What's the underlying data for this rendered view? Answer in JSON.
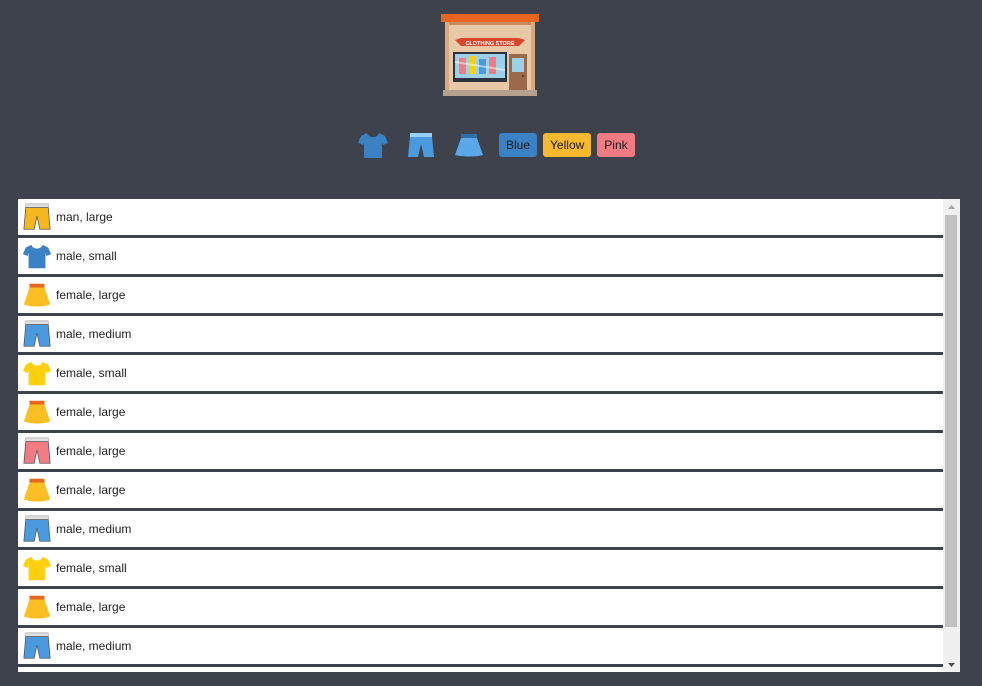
{
  "header": {
    "logo_icon": "clothing-store-icon",
    "logo_text": "CLOTHING STORE"
  },
  "filters": {
    "type_icons": [
      "tshirt-icon",
      "shorts-icon",
      "skirt-icon"
    ],
    "colors": [
      {
        "label": "Blue",
        "bg": "#3b82c4"
      },
      {
        "label": "Yellow",
        "bg": "#f5b82e"
      },
      {
        "label": "Pink",
        "bg": "#f07b82"
      }
    ]
  },
  "items": [
    {
      "type": "shorts",
      "color": "#f6b61d",
      "label": "man, large"
    },
    {
      "type": "tshirt",
      "color": "#3b82c4",
      "label": "male, small"
    },
    {
      "type": "skirt",
      "color": "#fbbf24",
      "label": "female, large"
    },
    {
      "type": "shorts",
      "color": "#4b9ae0",
      "label": "male, medium"
    },
    {
      "type": "tshirt",
      "color": "#fcd00f",
      "label": "female, small"
    },
    {
      "type": "skirt",
      "color": "#fbbf24",
      "label": "female, large"
    },
    {
      "type": "shorts",
      "color": "#f07b82",
      "label": "female, large"
    },
    {
      "type": "skirt",
      "color": "#fbbf24",
      "label": "female, large"
    },
    {
      "type": "shorts",
      "color": "#4b9ae0",
      "label": "male, medium"
    },
    {
      "type": "tshirt",
      "color": "#fcd00f",
      "label": "female, small"
    },
    {
      "type": "skirt",
      "color": "#fbbf24",
      "label": "female, large"
    },
    {
      "type": "shorts",
      "color": "#4b9ae0",
      "label": "male, medium"
    }
  ]
}
